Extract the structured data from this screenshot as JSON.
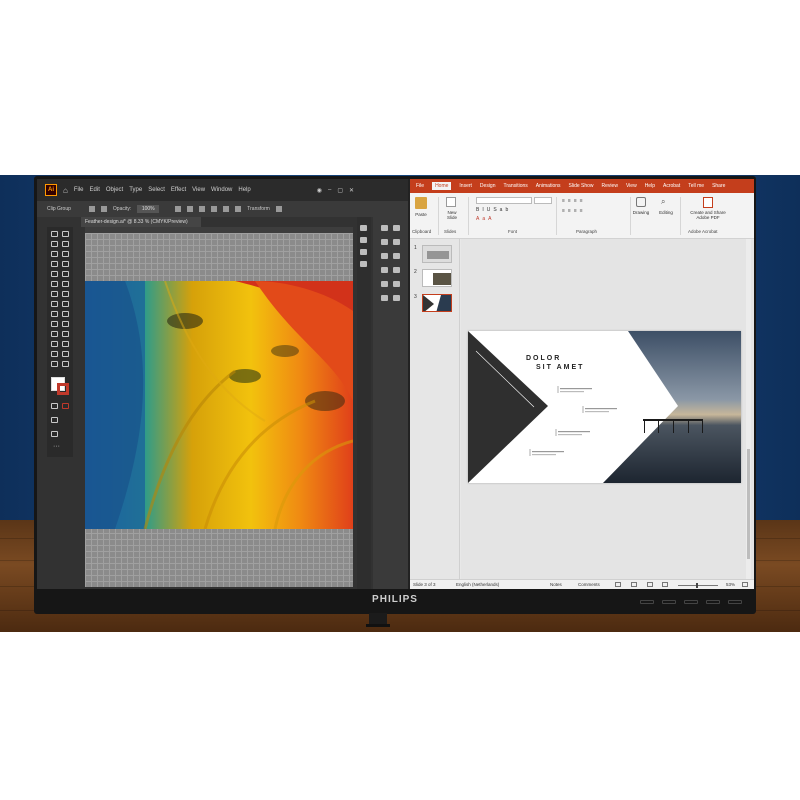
{
  "monitor": {
    "brand": "PHILIPS"
  },
  "illustrator": {
    "logo": "Ai",
    "menu": [
      "File",
      "Edit",
      "Object",
      "Type",
      "Select",
      "Effect",
      "View",
      "Window",
      "Help"
    ],
    "control": {
      "selection": "Clip Group",
      "opacity_label": "Opacity:",
      "opacity_value": "100%",
      "transform_label": "Transform"
    },
    "doc_tab": "Feather-design.ai* @ 8.33 % (CMYK/Preview)"
  },
  "powerpoint": {
    "tabs": [
      "File",
      "Home",
      "Insert",
      "Design",
      "Transitions",
      "Animations",
      "Slide Show",
      "Review",
      "View",
      "Help",
      "Acrobat",
      "Tell me",
      "Share"
    ],
    "active_tab": "Home",
    "ribbon": {
      "paste": "Paste",
      "new_slide": "New Slide",
      "drawing": "Drawing",
      "editing": "Editing",
      "create_pdf": "Create and Share Adobe PDF",
      "groups": [
        "Clipboard",
        "Slides",
        "Font",
        "Paragraph",
        "Adobe Acrobat"
      ]
    },
    "thumbnails": [
      "1",
      "2",
      "3"
    ],
    "slide": {
      "title_line1": "DOLOR",
      "title_line2": "SIT AMET"
    },
    "status": {
      "slide": "Slide 3 of 3",
      "language": "English (Netherlands)",
      "notes": "Notes",
      "comments": "Comments",
      "zoom": "53%"
    }
  }
}
